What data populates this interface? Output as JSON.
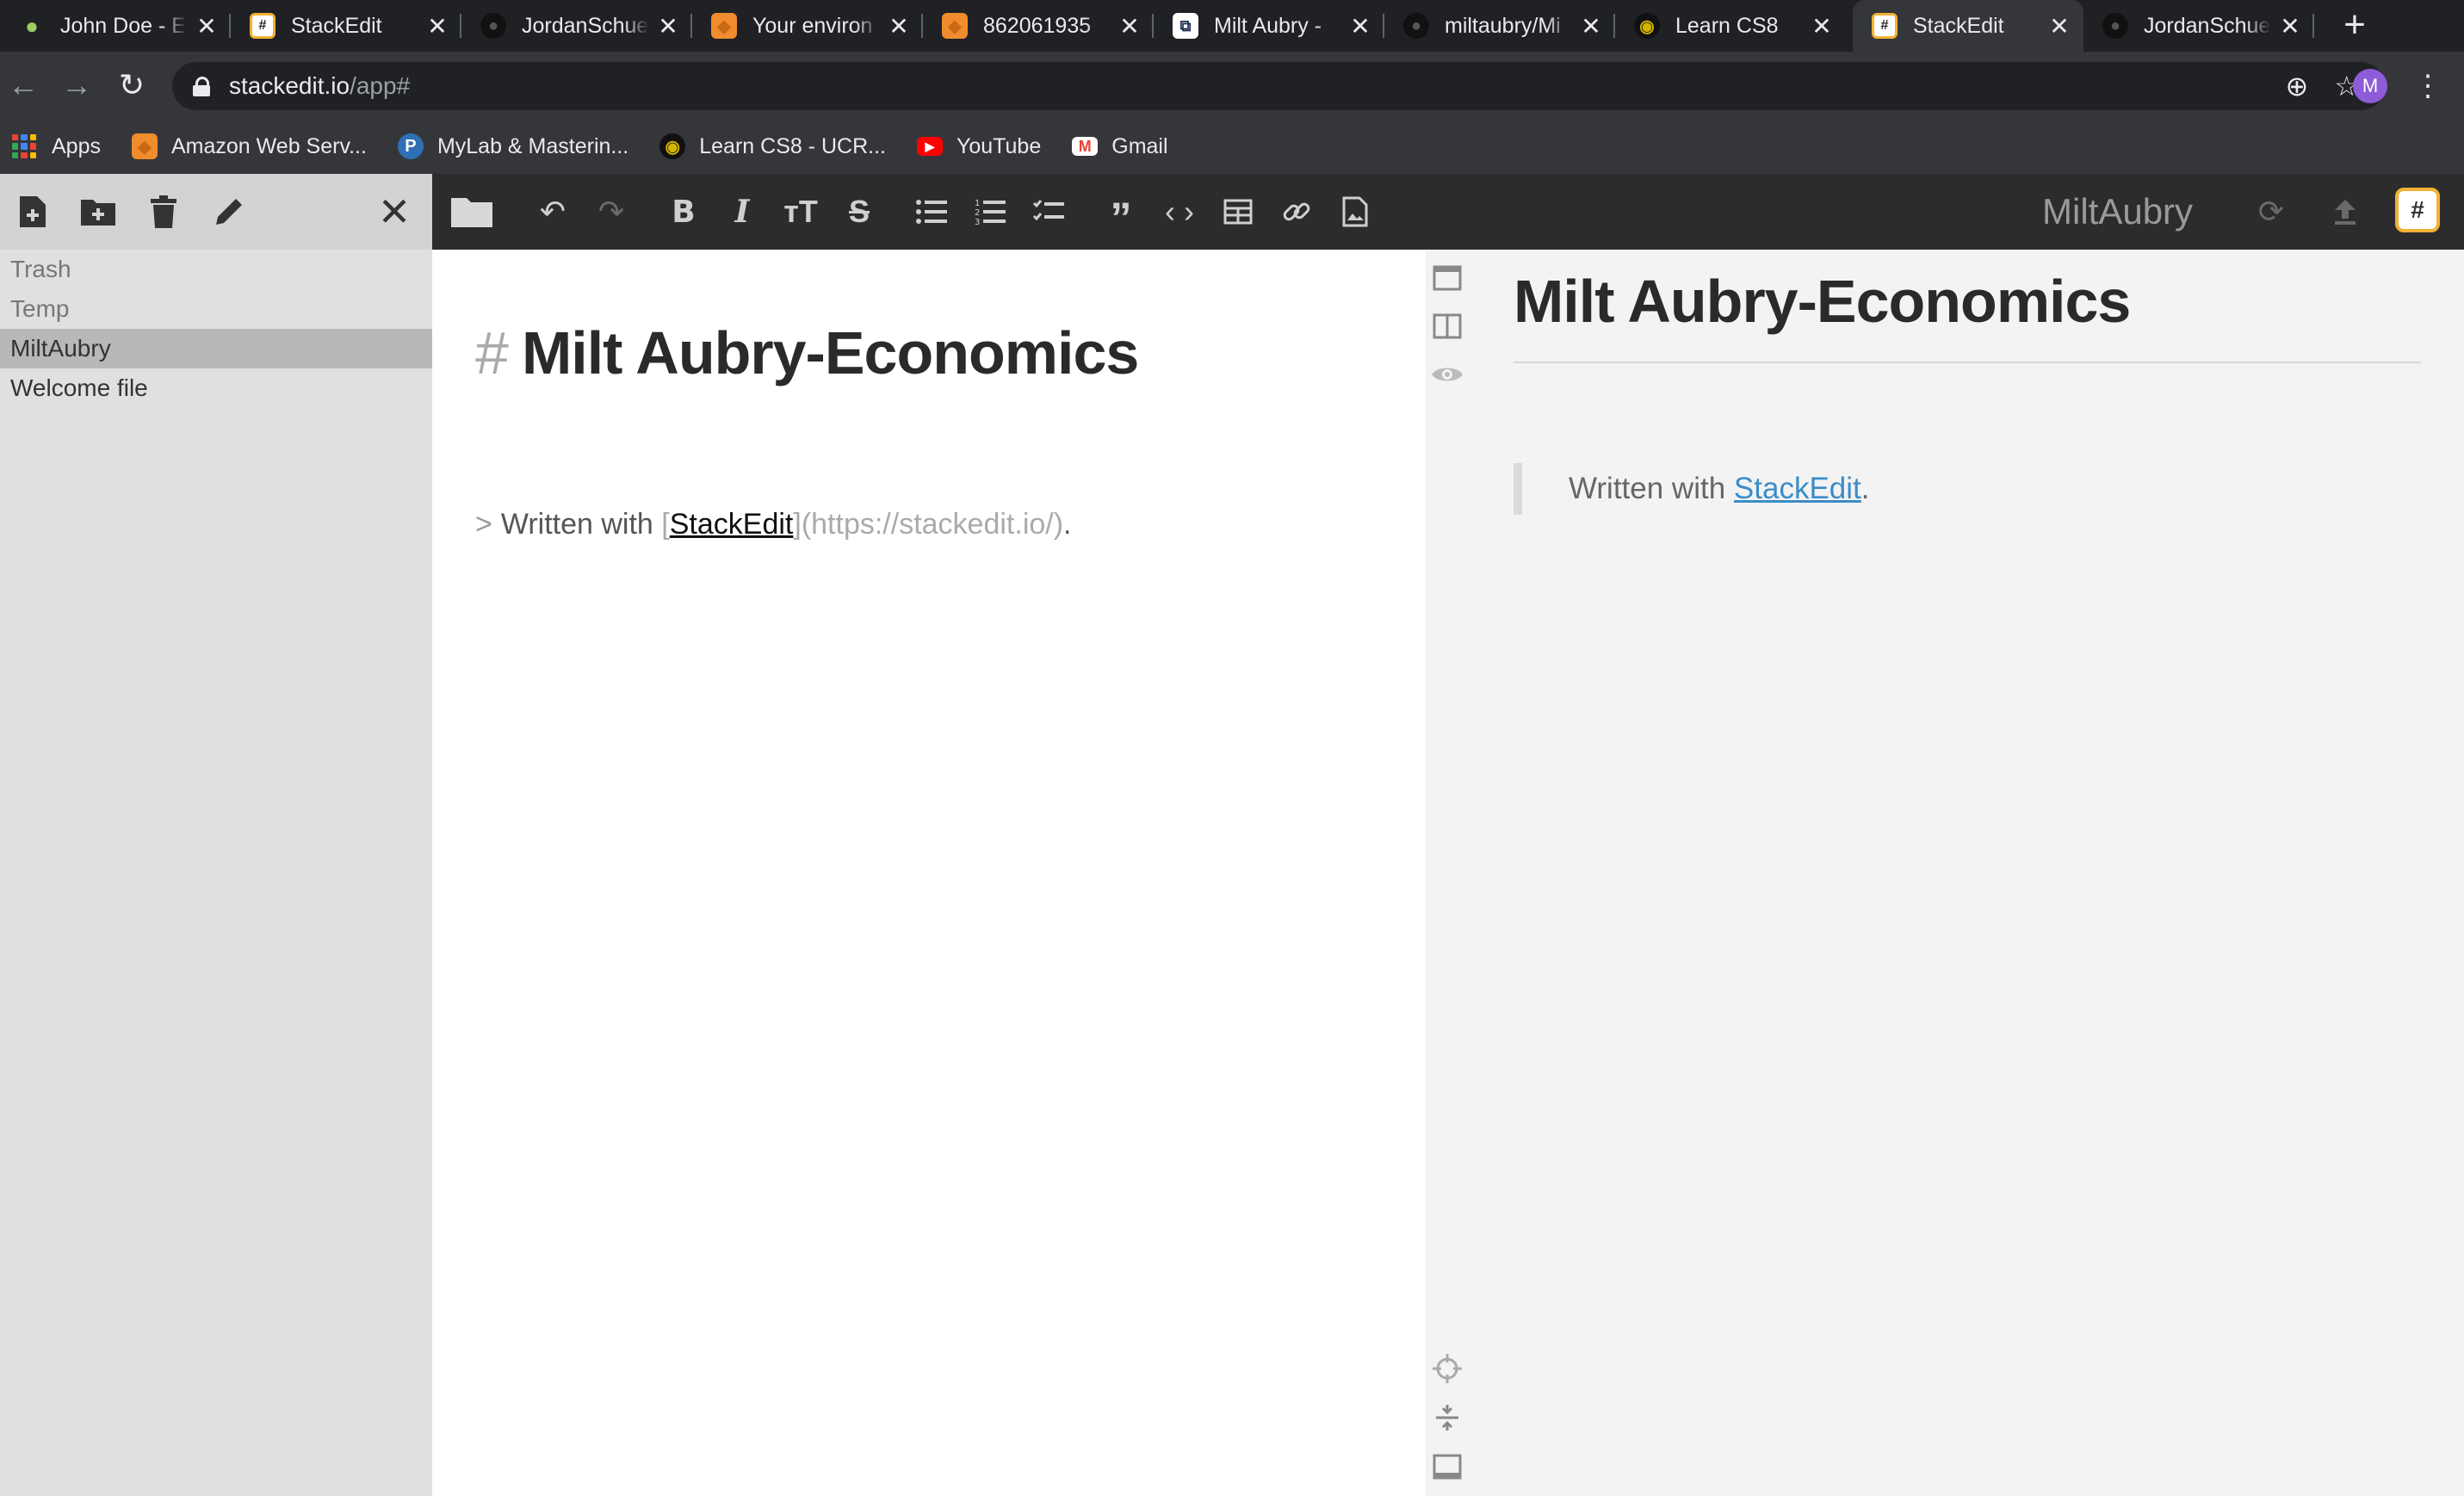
{
  "browser": {
    "tabs": [
      {
        "title": "John Doe - E",
        "favicon": "avocado-icon",
        "fav_color": "#6b8e23",
        "fav_glyph": "●",
        "active": false
      },
      {
        "title": "StackEdit",
        "favicon": "stackedit-icon",
        "fav_color": "#f2b233",
        "fav_glyph": "#",
        "active": false
      },
      {
        "title": "JordanSchue",
        "favicon": "github-icon",
        "fav_color": "#3a3a3a",
        "fav_glyph": "●",
        "active": false
      },
      {
        "title": "Your environ",
        "favicon": "aws-icon",
        "fav_color": "#f08c2e",
        "fav_glyph": "◆",
        "active": false
      },
      {
        "title": "862061935",
        "favicon": "aws-icon",
        "fav_color": "#f08c2e",
        "fav_glyph": "◆",
        "active": false
      },
      {
        "title": "Milt Aubry -",
        "favicon": "gitbook-icon",
        "fav_color": "#e8eaed",
        "fav_glyph": "⧉",
        "active": false
      },
      {
        "title": "miltaubry/Mi",
        "favicon": "github-icon",
        "fav_color": "#3a3a3a",
        "fav_glyph": "●",
        "active": false
      },
      {
        "title": "Learn CS8",
        "favicon": "owl-icon",
        "fav_color": "#d4b400",
        "fav_glyph": "◉",
        "active": false
      },
      {
        "title": "StackEdit",
        "favicon": "stackedit-icon",
        "fav_color": "#f2b233",
        "fav_glyph": "#",
        "active": true
      },
      {
        "title": "JordanSchue",
        "favicon": "github-icon",
        "fav_color": "#3a3a3a",
        "fav_glyph": "●",
        "active": false
      }
    ],
    "address": {
      "host": "stackedit.io",
      "path": "/app#"
    },
    "profile_initial": "M",
    "bookmarks": [
      {
        "label": "Apps",
        "icon": "apps-grid-icon"
      },
      {
        "label": "Amazon Web Serv...",
        "icon": "aws-icon",
        "color": "#f08c2e",
        "glyph": "◆"
      },
      {
        "label": "MyLab & Masterin...",
        "icon": "pearson-icon",
        "color": "#2e6fb5",
        "glyph": "P"
      },
      {
        "label": "Learn CS8 - UCR...",
        "icon": "owl-icon",
        "color": "#d4b400",
        "glyph": "◉"
      },
      {
        "label": "YouTube",
        "icon": "youtube-icon",
        "color": "#ff0000",
        "glyph": "▶"
      },
      {
        "label": "Gmail",
        "icon": "gmail-icon",
        "color": "#ffffff",
        "glyph": "M"
      }
    ]
  },
  "explorer": {
    "items": [
      {
        "label": "Trash",
        "type": "folder",
        "selected": false
      },
      {
        "label": "Temp",
        "type": "folder",
        "selected": false
      },
      {
        "label": "MiltAubry",
        "type": "folder",
        "selected": true
      },
      {
        "label": "Welcome file",
        "type": "file",
        "selected": false
      }
    ]
  },
  "navbar": {
    "workspace_title": "MiltAubry"
  },
  "editor": {
    "heading_mark": "#",
    "heading": "Milt Aubry-Economics",
    "quote_mark": ">",
    "quote_text": "Written with",
    "bracket_open": "[",
    "link_text": "StackEdit",
    "link_url_md": "](https://stackedit.io/)",
    "trailing": "."
  },
  "preview": {
    "heading": "Milt Aubry-Economics",
    "quote_text": "Written with",
    "link_text": "StackEdit",
    "trailing": "."
  },
  "colors": {
    "accent_link": "#3c8cc8",
    "logo_border": "#f2b233"
  }
}
